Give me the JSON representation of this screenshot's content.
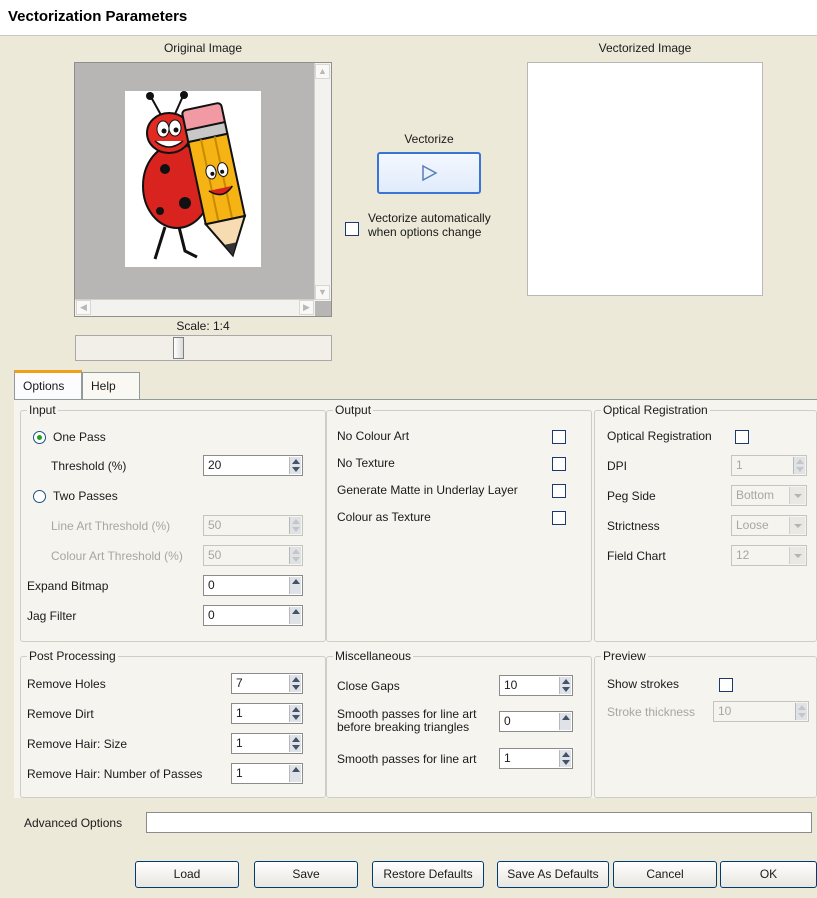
{
  "window": {
    "title": "Vectorization Parameters"
  },
  "original": {
    "label": "Original Image",
    "scale_label": "Scale: 1:4",
    "scale_fraction": 0.4
  },
  "vectorized": {
    "label": "Vectorized Image"
  },
  "vectorize": {
    "label": "Vectorize",
    "button_icon": "play-arrow-icon",
    "auto_label_line1": "Vectorize automatically",
    "auto_label_line2": "when options change",
    "auto_checked": false
  },
  "tabs": [
    {
      "label": "Options",
      "active": true
    },
    {
      "label": "Help",
      "active": false
    }
  ],
  "input": {
    "title": "Input",
    "one_pass": "One Pass",
    "threshold_label": "Threshold (%)",
    "threshold_value": "20",
    "two_passes": "Two Passes",
    "line_art_label": "Line Art Threshold (%)",
    "line_art_value": "50",
    "colour_art_label": "Colour Art Threshold (%)",
    "colour_art_value": "50",
    "expand_label": "Expand Bitmap",
    "expand_value": "0",
    "jag_label": "Jag Filter",
    "jag_value": "0"
  },
  "output": {
    "title": "Output",
    "no_colour_art": "No Colour Art",
    "no_texture": "No Texture",
    "generate_matte": "Generate Matte in Underlay Layer",
    "colour_as_texture": "Colour as Texture"
  },
  "optical": {
    "title": "Optical Registration",
    "optical_label": "Optical Registration",
    "dpi_label": "DPI",
    "dpi_value": "1",
    "peg_label": "Peg Side",
    "peg_value": "Bottom",
    "strict_label": "Strictness",
    "strict_value": "Loose",
    "field_label": "Field Chart",
    "field_value": "12"
  },
  "post": {
    "title": "Post Processing",
    "holes_label": "Remove Holes",
    "holes_value": "7",
    "dirt_label": "Remove Dirt",
    "dirt_value": "1",
    "hair_size_label": "Remove Hair: Size",
    "hair_size_value": "1",
    "hair_passes_label": "Remove Hair: Number of Passes",
    "hair_passes_value": "1"
  },
  "misc": {
    "title": "Miscellaneous",
    "gaps_label": "Close Gaps",
    "gaps_value": "10",
    "smooth1_line1": "Smooth passes for line art",
    "smooth1_line2": "before breaking triangles",
    "smooth1_value": "0",
    "smooth2_label": "Smooth passes for line art",
    "smooth2_value": "1"
  },
  "preview": {
    "title": "Preview",
    "strokes_label": "Show strokes",
    "thickness_label": "Stroke thickness",
    "thickness_value": "10"
  },
  "advanced": {
    "label": "Advanced Options",
    "value": ""
  },
  "buttons": {
    "load": "Load",
    "save": "Save",
    "restore": "Restore Defaults",
    "save_defaults": "Save As Defaults",
    "cancel": "Cancel",
    "ok": "OK"
  }
}
